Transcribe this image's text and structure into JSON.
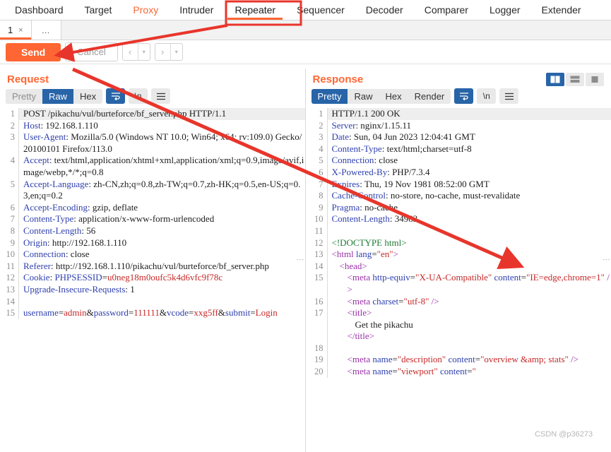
{
  "topnav": {
    "tabs": [
      {
        "label": "Dashboard",
        "state": "normal"
      },
      {
        "label": "Target",
        "state": "normal"
      },
      {
        "label": "Proxy",
        "state": "accent"
      },
      {
        "label": "Intruder",
        "state": "normal"
      },
      {
        "label": "Repeater",
        "state": "active"
      },
      {
        "label": "Sequencer",
        "state": "normal"
      },
      {
        "label": "Decoder",
        "state": "normal"
      },
      {
        "label": "Comparer",
        "state": "normal"
      },
      {
        "label": "Logger",
        "state": "normal"
      },
      {
        "label": "Extender",
        "state": "normal"
      }
    ]
  },
  "tabstrip": {
    "tab_number": "1",
    "close_glyph": "×",
    "more_label": "…"
  },
  "actionbar": {
    "send_label": "Send",
    "cancel_label": "Cancel",
    "prev_glyph": "‹",
    "next_glyph": "›",
    "caret_glyph": "▾"
  },
  "viewtoggles": {
    "split_vertical": "split-vertical-view",
    "split_horizontal": "split-horizontal-view",
    "single": "single-view",
    "selected": "split_vertical"
  },
  "request": {
    "title": "Request",
    "modes": [
      "Pretty",
      "Raw",
      "Hex"
    ],
    "selected_mode": "Raw",
    "wrap_icon": "word-wrap-icon",
    "newline_label": "\\n",
    "menu_icon": "hamburger-menu-icon",
    "lines": [
      {
        "n": "1",
        "hl": true,
        "parts": [
          {
            "t": "POST /pikachu/vul/burteforce/bf_server.php HTTP/1.1",
            "c": "v"
          }
        ]
      },
      {
        "n": "2",
        "parts": [
          {
            "t": "Host",
            "c": "k"
          },
          {
            "t": ": 192.168.1.110",
            "c": "v"
          }
        ]
      },
      {
        "n": "3",
        "parts": [
          {
            "t": "User-Agent",
            "c": "k"
          },
          {
            "t": ": Mozilla/5.0 (Windows NT 10.0; Win64; x64; rv:109.0) Gecko/20100101 Firefox/113.0",
            "c": "v"
          }
        ]
      },
      {
        "n": "4",
        "parts": [
          {
            "t": "Accept",
            "c": "k"
          },
          {
            "t": ": text/html,application/xhtml+xml,application/xml;q=0.9,image/avif,image/webp,*/*;q=0.8",
            "c": "v"
          }
        ]
      },
      {
        "n": "5",
        "parts": [
          {
            "t": "Accept-Language",
            "c": "k"
          },
          {
            "t": ": zh-CN,zh;q=0.8,zh-TW;q=0.7,zh-HK;q=0.5,en-US;q=0.3,en;q=0.2",
            "c": "v"
          }
        ]
      },
      {
        "n": "6",
        "parts": [
          {
            "t": "Accept-Encoding",
            "c": "k"
          },
          {
            "t": ": gzip, deflate",
            "c": "v"
          }
        ]
      },
      {
        "n": "7",
        "parts": [
          {
            "t": "Content-Type",
            "c": "k"
          },
          {
            "t": ": application/x-www-form-urlencoded",
            "c": "v"
          }
        ]
      },
      {
        "n": "8",
        "parts": [
          {
            "t": "Content-Length",
            "c": "k"
          },
          {
            "t": ": 56",
            "c": "v"
          }
        ]
      },
      {
        "n": "9",
        "parts": [
          {
            "t": "Origin",
            "c": "k"
          },
          {
            "t": ": http://192.168.1.110",
            "c": "v"
          }
        ]
      },
      {
        "n": "10",
        "parts": [
          {
            "t": "Connection",
            "c": "k"
          },
          {
            "t": ": close",
            "c": "v"
          }
        ]
      },
      {
        "n": "11",
        "parts": [
          {
            "t": "Referer",
            "c": "k"
          },
          {
            "t": ": http://192.168.1.110/pikachu/vul/burteforce/bf_server.php",
            "c": "v"
          }
        ]
      },
      {
        "n": "12",
        "parts": [
          {
            "t": "Cookie",
            "c": "k"
          },
          {
            "t": ": ",
            "c": "v"
          },
          {
            "t": "PHPSESSID",
            "c": "k"
          },
          {
            "t": "=",
            "c": "v"
          },
          {
            "t": "u0neg18m0oufc5k4d6vfc9f78c",
            "c": "rd"
          }
        ]
      },
      {
        "n": "13",
        "parts": [
          {
            "t": "Upgrade-Insecure-Requests",
            "c": "k"
          },
          {
            "t": ": 1",
            "c": "v"
          }
        ]
      },
      {
        "n": "14",
        "parts": [
          {
            "t": "",
            "c": "v"
          }
        ]
      },
      {
        "n": "15",
        "parts": [
          {
            "t": "username",
            "c": "k"
          },
          {
            "t": "=",
            "c": "v"
          },
          {
            "t": "admin",
            "c": "rd"
          },
          {
            "t": "&",
            "c": "v"
          },
          {
            "t": "password",
            "c": "k"
          },
          {
            "t": "=",
            "c": "v"
          },
          {
            "t": "111111",
            "c": "rd"
          },
          {
            "t": "&",
            "c": "v"
          },
          {
            "t": "vcode",
            "c": "k"
          },
          {
            "t": "=",
            "c": "v"
          },
          {
            "t": "xxg5ff",
            "c": "rd"
          },
          {
            "t": "&",
            "c": "v"
          },
          {
            "t": "submit",
            "c": "k"
          },
          {
            "t": "=",
            "c": "v"
          },
          {
            "t": "Login",
            "c": "rd"
          }
        ]
      }
    ]
  },
  "response": {
    "title": "Response",
    "modes": [
      "Pretty",
      "Raw",
      "Hex",
      "Render"
    ],
    "selected_mode": "Pretty",
    "wrap_icon": "word-wrap-icon",
    "newline_label": "\\n",
    "menu_icon": "hamburger-menu-icon",
    "lines": [
      {
        "n": "1",
        "hl": true,
        "parts": [
          {
            "t": "HTTP/1.1 200 OK",
            "c": "v"
          }
        ]
      },
      {
        "n": "2",
        "parts": [
          {
            "t": "Server",
            "c": "k"
          },
          {
            "t": ": nginx/1.15.11",
            "c": "v"
          }
        ]
      },
      {
        "n": "3",
        "parts": [
          {
            "t": "Date",
            "c": "k"
          },
          {
            "t": ": Sun, 04 Jun 2023 12:04:41 GMT",
            "c": "v"
          }
        ]
      },
      {
        "n": "4",
        "parts": [
          {
            "t": "Content-Type",
            "c": "k"
          },
          {
            "t": ": text/html;charset=utf-8",
            "c": "v"
          }
        ]
      },
      {
        "n": "5",
        "parts": [
          {
            "t": "Connection",
            "c": "k"
          },
          {
            "t": ": close",
            "c": "v"
          }
        ]
      },
      {
        "n": "6",
        "parts": [
          {
            "t": "X-Powered-By",
            "c": "k"
          },
          {
            "t": ": PHP/7.3.4",
            "c": "v"
          }
        ]
      },
      {
        "n": "7",
        "parts": [
          {
            "t": "Expires",
            "c": "k"
          },
          {
            "t": ": Thu, 19 Nov 1981 08:52:00 GMT",
            "c": "v"
          }
        ]
      },
      {
        "n": "8",
        "parts": [
          {
            "t": "Cache-Control",
            "c": "k"
          },
          {
            "t": ": no-store, no-cache, must-revalidate",
            "c": "v"
          }
        ]
      },
      {
        "n": "9",
        "parts": [
          {
            "t": "Pragma",
            "c": "k"
          },
          {
            "t": ": no-cache",
            "c": "v"
          }
        ]
      },
      {
        "n": "10",
        "parts": [
          {
            "t": "Content-Length",
            "c": "k"
          },
          {
            "t": ": 34983",
            "c": "v"
          }
        ]
      },
      {
        "n": "11",
        "parts": [
          {
            "t": "",
            "c": "v"
          }
        ]
      },
      {
        "n": "12",
        "parts": [
          {
            "t": "<!DOCTYPE html>",
            "c": "cmt"
          }
        ]
      },
      {
        "n": "13",
        "parts": [
          {
            "t": "<html ",
            "c": "tag"
          },
          {
            "t": "lang",
            "c": "attr"
          },
          {
            "t": "=",
            "c": "v"
          },
          {
            "t": "\"en\"",
            "c": "str"
          },
          {
            "t": ">",
            "c": "tag"
          }
        ]
      },
      {
        "n": "14",
        "indent": 1,
        "parts": [
          {
            "t": "<head>",
            "c": "tag"
          }
        ]
      },
      {
        "n": "15",
        "indent": 2,
        "parts": [
          {
            "t": "<meta ",
            "c": "tag"
          },
          {
            "t": "http-equiv",
            "c": "attr"
          },
          {
            "t": "=",
            "c": "v"
          },
          {
            "t": "\"X-UA-Compatible\"",
            "c": "str"
          },
          {
            "t": " ",
            "c": "v"
          },
          {
            "t": "content",
            "c": "attr"
          },
          {
            "t": "=",
            "c": "v"
          },
          {
            "t": "\"IE=edge,chrome=1\"",
            "c": "str"
          },
          {
            "t": " />",
            "c": "tag"
          }
        ]
      },
      {
        "n": "16",
        "indent": 2,
        "parts": [
          {
            "t": "<meta ",
            "c": "tag"
          },
          {
            "t": "charset",
            "c": "attr"
          },
          {
            "t": "=",
            "c": "v"
          },
          {
            "t": "\"utf-8\"",
            "c": "str"
          },
          {
            "t": " />",
            "c": "tag"
          }
        ]
      },
      {
        "n": "17",
        "indent": 2,
        "parts": [
          {
            "t": "<title>",
            "c": "tag"
          }
        ]
      },
      {
        "n": "",
        "indent": 3,
        "parts": [
          {
            "t": "Get the pikachu",
            "c": "v"
          }
        ]
      },
      {
        "n": "",
        "indent": 2,
        "parts": [
          {
            "t": "</title>",
            "c": "tag"
          }
        ]
      },
      {
        "n": "18",
        "parts": [
          {
            "t": "",
            "c": "v"
          }
        ]
      },
      {
        "n": "19",
        "indent": 2,
        "parts": [
          {
            "t": "<meta ",
            "c": "tag"
          },
          {
            "t": "name",
            "c": "attr"
          },
          {
            "t": "=",
            "c": "v"
          },
          {
            "t": "\"description\"",
            "c": "str"
          },
          {
            "t": " ",
            "c": "v"
          },
          {
            "t": "content",
            "c": "attr"
          },
          {
            "t": "=",
            "c": "v"
          },
          {
            "t": "\"overview &amp; stats\"",
            "c": "str"
          },
          {
            "t": " />",
            "c": "tag"
          }
        ]
      },
      {
        "n": "20",
        "indent": 2,
        "parts": [
          {
            "t": "<meta ",
            "c": "tag"
          },
          {
            "t": "name",
            "c": "attr"
          },
          {
            "t": "=",
            "c": "v"
          },
          {
            "t": "\"viewport\"",
            "c": "str"
          },
          {
            "t": " ",
            "c": "v"
          },
          {
            "t": "content",
            "c": "attr"
          },
          {
            "t": "=",
            "c": "v"
          },
          {
            "t": "\"",
            "c": "str"
          }
        ]
      }
    ]
  },
  "annotations": {
    "highlight_box_target": "Repeater",
    "watermark": "CSDN @p36273",
    "arrow_color": "#e8352b",
    "box_color": "#e8352b"
  },
  "colors": {
    "accent": "#ff6633",
    "selected_blue": "#2864a8",
    "header_blue": "#2e3fae",
    "value_red": "#c62828",
    "tag_purple": "#9b30a8",
    "doctype_green": "#1d7a33"
  }
}
